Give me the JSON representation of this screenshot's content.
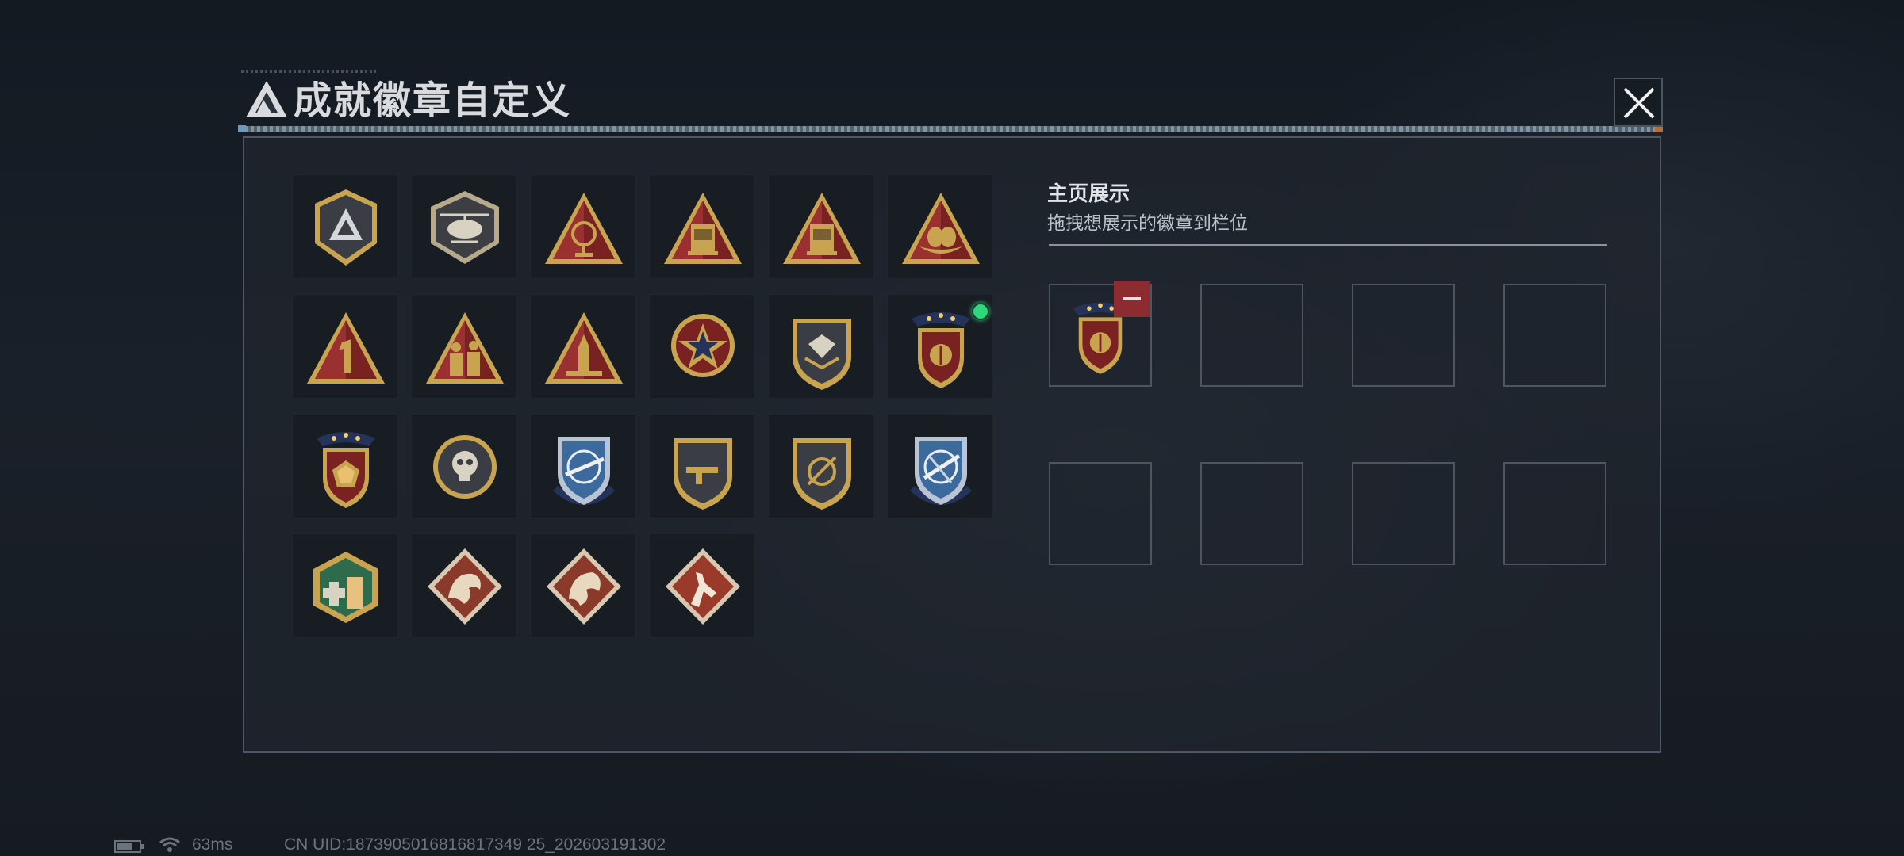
{
  "header": {
    "title": "成就徽章自定义",
    "logo_icon": "triangle-logo-icon",
    "close_icon": "close-icon"
  },
  "badges": [
    {
      "icon": "shield-triangle-badge-icon"
    },
    {
      "icon": "helicopter-badge-icon"
    },
    {
      "icon": "satellite-dish-badge-icon"
    },
    {
      "icon": "crate-57-badge-icon"
    },
    {
      "icon": "crate-58-badge-icon"
    },
    {
      "icon": "egg-nest-badge-icon"
    },
    {
      "icon": "number-one-badge-icon"
    },
    {
      "icon": "soldiers-badge-icon"
    },
    {
      "icon": "rocket-badge-icon"
    },
    {
      "icon": "star-medal-badge-icon"
    },
    {
      "icon": "winged-shield-badge-icon"
    },
    {
      "icon": "starred-crest-badge-icon",
      "new": true
    },
    {
      "icon": "gem-crest-badge-icon"
    },
    {
      "icon": "skull-emblem-badge-icon"
    },
    {
      "icon": "sniper-rifle-blue-badge-icon"
    },
    {
      "icon": "smg-shield-badge-icon"
    },
    {
      "icon": "crossed-shield-badge-icon"
    },
    {
      "icon": "sniper-blade-blue-badge-icon"
    },
    {
      "icon": "medic-hexagon-badge-icon"
    },
    {
      "icon": "dragon-badge-icon"
    },
    {
      "icon": "dragon-alt-badge-icon"
    },
    {
      "icon": "rabbit-runner-badge-icon"
    }
  ],
  "showcase": {
    "title": "主页展示",
    "subtitle": "拖拽想展示的徽章到栏位",
    "slots": [
      {
        "badge": "starred-crest-badge-icon"
      },
      {
        "badge": null
      },
      {
        "badge": null
      },
      {
        "badge": null
      },
      {
        "badge": null
      },
      {
        "badge": null
      },
      {
        "badge": null
      },
      {
        "badge": null
      }
    ],
    "remove_icon": "minus-icon"
  },
  "status_bar": {
    "battery_icon": "battery-icon",
    "wifi_icon": "wifi-icon",
    "ping": "63ms",
    "uid": "CN UID:1873905016816817349 25_202603191302"
  },
  "colors": {
    "gold": "#c9a450",
    "dark_red": "#7a2222",
    "navy": "#25335a",
    "new_dot": "#2fd87c",
    "remove_red": "#8c2c30"
  }
}
